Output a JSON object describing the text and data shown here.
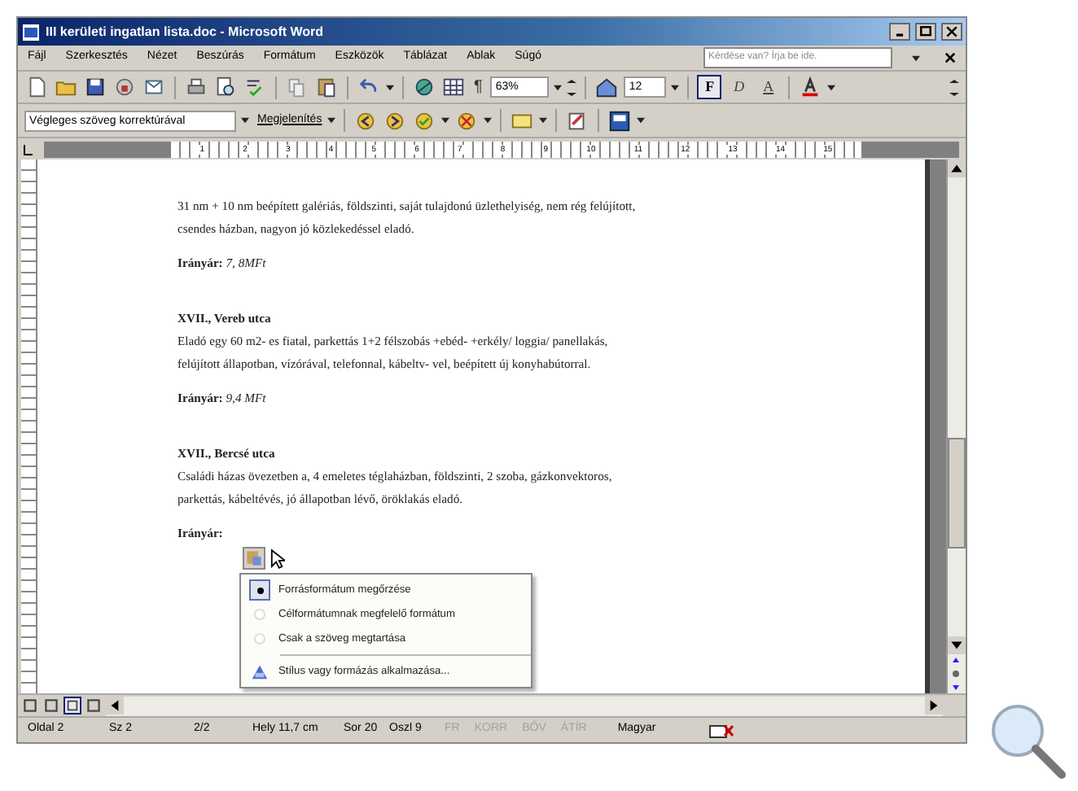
{
  "window": {
    "title": "III kerületi ingatlan lista.doc - Microsoft Word"
  },
  "menu": [
    "Fájl",
    "Szerkesztés",
    "Nézet",
    "Beszúrás",
    "Formátum",
    "Eszközök",
    "Táblázat",
    "Ablak",
    "Súgó"
  ],
  "help_box": {
    "placeholder": "Kérdése van? Írja be ide."
  },
  "toolbar": {
    "zoom": "63%",
    "pilcrow": "¶",
    "font_size": "12",
    "format_buttons": [
      {
        "label": "F",
        "selected": true
      },
      {
        "label": "D",
        "selected": false
      },
      {
        "label": "A",
        "selected": false
      }
    ]
  },
  "review_toolbar": {
    "display_mode": "Végleges szöveg korrektúrával",
    "show_menu": "Megjelenítés"
  },
  "ruler": {
    "numbers": [
      "1",
      "2",
      "3",
      "4",
      "5",
      "6",
      "7",
      "8",
      "9",
      "10",
      "11",
      "12",
      "13",
      "14",
      "15"
    ]
  },
  "document": {
    "paragraphs": [
      {
        "kind": "text",
        "text": "31 nm + 10 nm beépített galériás, földszinti, saját tulajdonú üzlethelyiség, nem rég felújított,"
      },
      {
        "kind": "text",
        "text": "csendes házban, nagyon jó közlekedéssel eladó."
      },
      {
        "kind": "price",
        "text": "**Irányár:** *7, 8MFt*"
      },
      {
        "kind": "heading",
        "text": "XVII., Vereb utca"
      },
      {
        "kind": "text",
        "text": "Eladó egy 60 m2- es fiatal, parkettás 1+2 félszobás +ebéd- +erkély/ loggia/ panellakás,"
      },
      {
        "kind": "text",
        "text": "felújított állapotban, vízórával, telefonnal, kábeltv- vel, beépített új konyhabútorral."
      },
      {
        "kind": "price",
        "text": "**Irányár:** *9,4 MFt*"
      },
      {
        "kind": "heading",
        "text": "XVII., Bercsé utca"
      },
      {
        "kind": "text",
        "text": "Családi házas övezetben a, 4 emeletes téglaházban, földszinti, 2 szoba, gázkonvektoros,"
      },
      {
        "kind": "text",
        "text": "parkettás, kábeltévés, jó állapotban lévő, öröklakás eladó."
      },
      {
        "kind": "price",
        "text": "**Irányár:**"
      }
    ]
  },
  "paste_menu": {
    "items": [
      {
        "kind": "radio",
        "label": "Forrásformátum megőrzése",
        "selected": true
      },
      {
        "kind": "radio",
        "label": "Célformátumnak megfelelő formátum",
        "selected": false
      },
      {
        "kind": "radio",
        "label": "Csak a szöveg megtartása",
        "selected": false
      },
      {
        "kind": "action",
        "label": "Stílus vagy formázás alkalmazása..."
      }
    ]
  },
  "view_buttons": [
    {
      "selected": false
    },
    {
      "selected": false
    },
    {
      "selected": true
    },
    {
      "selected": false
    }
  ],
  "status_bar": {
    "fields": [
      "Oldal 2",
      "Sz 2",
      "2/2",
      "Hely 11,7 cm",
      "Sor 20",
      "Oszl 9"
    ],
    "modes": [
      {
        "label": "FR",
        "disabled": true
      },
      {
        "label": "KORR",
        "disabled": true
      },
      {
        "label": "BŐV",
        "disabled": true
      },
      {
        "label": "ÁTÍR",
        "disabled": true
      }
    ],
    "language": "Magyar"
  }
}
